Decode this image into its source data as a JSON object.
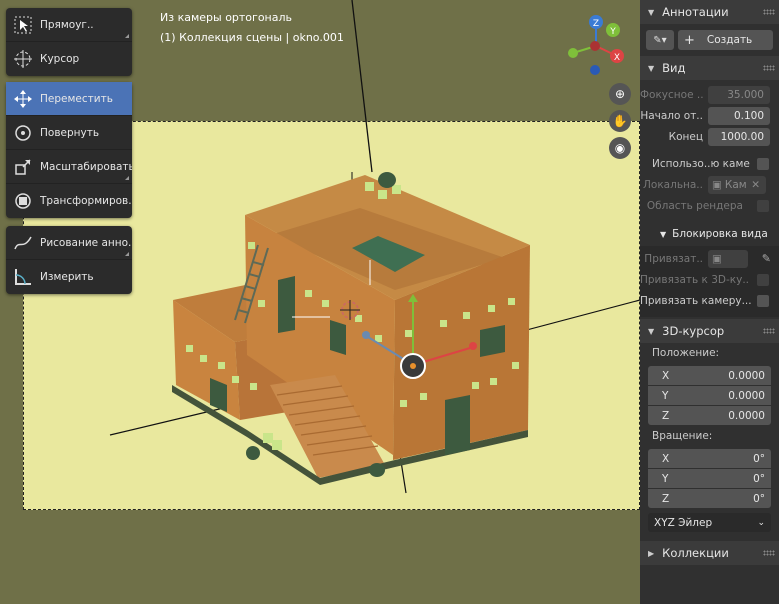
{
  "viewport": {
    "view_name": "Из камеры ортогональ",
    "collection_info": "(1) Коллекция сцены | okno.001"
  },
  "toolbar": {
    "select": "Прямоуг..",
    "cursor": "Курсор",
    "move": "Переместить",
    "rotate": "Повернуть",
    "scale": "Масштабировать",
    "transform": "Трансформиров..",
    "annotate": "Рисование анно..",
    "measure": "Измерить"
  },
  "gizmo": {
    "z": "Z",
    "y": "Y",
    "x": "X"
  },
  "panel": {
    "annotations": {
      "title": "Аннотации",
      "create_label": "Создать"
    },
    "view": {
      "title": "Вид",
      "focal_label": "Фокусное ..",
      "focal_value": "35.000",
      "clip_start_label": "Начало от..",
      "clip_start_value": "0.100",
      "clip_end_label": "Конец",
      "clip_end_value": "1000.00",
      "use_camera_label": "Использо..ю камеру",
      "local_label": "Локальна..",
      "local_value": "Кам",
      "render_region_label": "Область рендера"
    },
    "lock": {
      "title": "Блокировка вида",
      "lock_to_label": "Привязат..",
      "lock_3d_cursor_label": "Привязать к 3D-ку..",
      "lock_camera_label": "Привязать камеру..."
    },
    "cursor3d": {
      "title": "3D-курсор",
      "location_label": "Положение:",
      "loc": [
        {
          "axis": "X",
          "value": "0.0000"
        },
        {
          "axis": "Y",
          "value": "0.0000"
        },
        {
          "axis": "Z",
          "value": "0.0000"
        }
      ],
      "rotation_label": "Вращение:",
      "rot": [
        {
          "axis": "X",
          "value": "0°"
        },
        {
          "axis": "Y",
          "value": "0°"
        },
        {
          "axis": "Z",
          "value": "0°"
        }
      ],
      "mode": "XYZ Эйлер"
    },
    "collections": {
      "title": "Коллекции"
    }
  }
}
